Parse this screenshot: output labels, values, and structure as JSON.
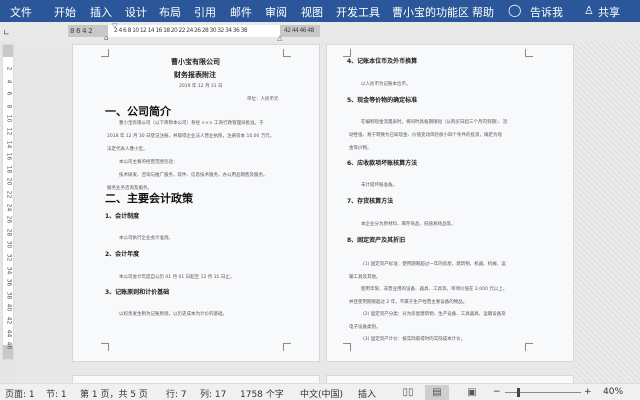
{
  "menu": {
    "items": [
      "文件",
      "开始",
      "插入",
      "设计",
      "布局",
      "引用",
      "邮件",
      "审阅",
      "视图",
      "开发工具",
      "曹小宝的功能区",
      "帮助"
    ],
    "tell_me": "告诉我",
    "share": "共享"
  },
  "ruler": {
    "left_margin": "8 6 4 2",
    "main": "2 4 6 8 10 12 14 16 18 20 22 24 26 28 30 32 34 36 38",
    "right_margin": "42 44 46 48",
    "vertical": [
      "2",
      "4",
      "6",
      "8",
      "10",
      "12",
      "14",
      "16",
      "18",
      "20",
      "22",
      "24",
      "26",
      "28",
      "30",
      "32",
      "34",
      "36",
      "38",
      "40",
      "42",
      "44",
      "46"
    ]
  },
  "page1": {
    "title": "曹小宝有限公司",
    "subtitle": "财务报表附注",
    "date": "2019 年 12 月 31 日",
    "unit": "单位：人民币元",
    "h_company": "一、公司简介",
    "p1": "曹小宝有限公司（以下简称本公司）系经 ××× 工商行政管理局批准，于",
    "p2": "2018 年 12 月 30 日登记注册，并取得企业法人营业执照，注册资本 10.00 万元，",
    "p3": "法定代表人曹小宝。",
    "p4": "本公司主要的经营范围包括：",
    "p5": "技术研发、咨询与推广服务，软件、信息技术服务，办公用品销售及服务。",
    "p6": "服务业务咨询及服务。",
    "h_policy": "二、主要会计政策",
    "s1": "1、会计制度",
    "s1p": "本公司执行企业会计准则。",
    "s2": "2、会计年度",
    "s2p": "本公司会计年度自公历 01 月 01 日起至 12 月 31 日止。",
    "s3": "3、记账原则和计价基础",
    "s3p": "以权责发生制为记账原则，以历史成本为计价的基础。"
  },
  "page2": {
    "s4": "4、记账本位币及外币换算",
    "s4p": "以人民币为记账本位币。",
    "s5": "5、现金等价物的确定标准",
    "s5p1": "在编制现金流量表时，将同时具备期限短（从购买日起三个月内到期）、流",
    "s5p2": "动性强、易于转换为已知现金、价值变动风险很小四个条件的投资，确定为现",
    "s5p3": "金等价物。",
    "s6": "6、应收款项坏账核算方法",
    "s6p": "未计提坏账准备。",
    "s7": "7、存货核算方法",
    "s7p": "本企业分为原材料、库存商品、低值易耗品等。",
    "s8": "8、固定资产及其折旧",
    "s8p1": "(1) 固定资产标准：使用期限超过一年的房屋、建筑物、机器、机械、运",
    "s8p2": "输工具及其他。",
    "s8p3": "使用年限、非营业用的设备、器具、工具等，单项价值在 2,000 元以上，",
    "s8p4": "并且使用期限超过 2 年，不属于生产经营主要设备的物品。",
    "s8p5": "(2) 固定资产分类：分为房屋建筑物、生产设备、工具器具、运输设备及",
    "s8p6": "电子设备类别。",
    "s8p7": "(3) 固定资产计价：按实际取得时的实际成本计价。"
  },
  "status": {
    "page": "页面: 1",
    "section": "节: 1",
    "page_of": "第 1 页，共 5 页",
    "row": "行: 7",
    "col": "列: 17",
    "words": "1758 个字",
    "lang": "中文(中国)",
    "mode": "插入",
    "zoom": "40%",
    "zoom_level_percent": 40
  }
}
